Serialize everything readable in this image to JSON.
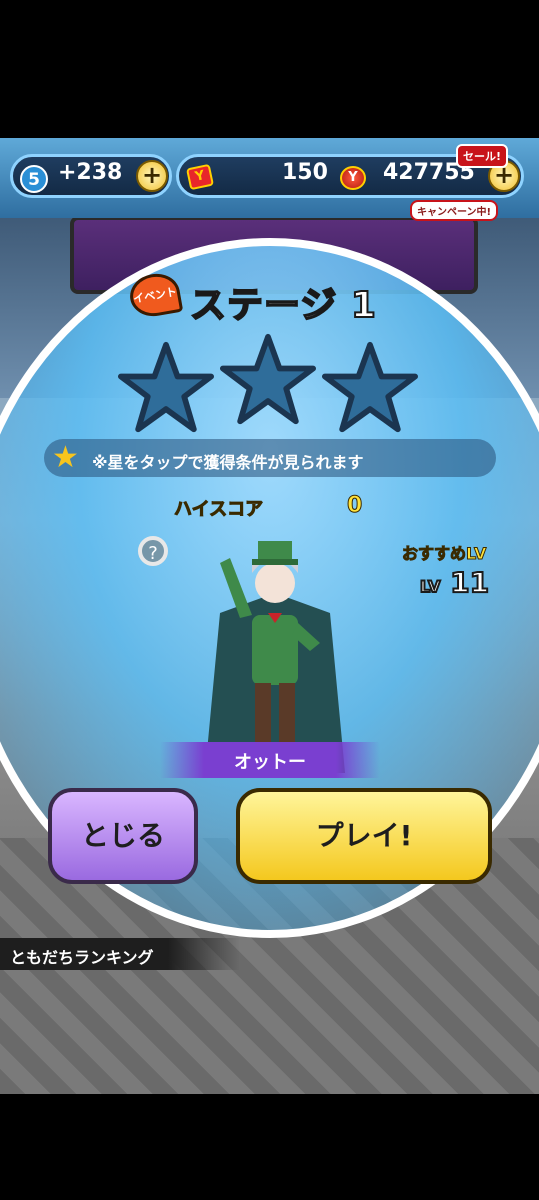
{
  "hud": {
    "stamina_level": "5",
    "stamina_bonus": "+238",
    "ticket_count": "150",
    "money_count": "427755",
    "sale_badge": "セール!",
    "campaign_badge": "キャンペーン中!",
    "plus_label": "+"
  },
  "stage": {
    "event_ribbon": "イベント",
    "title": "ステージ 1",
    "stars_earned": 0,
    "stars_total": 3,
    "hint_text": "※星をタップで獲得条件が見られます",
    "highscore_label": "ハイスコア",
    "highscore_value": "0",
    "recommended_label": "おすすめLV",
    "recommended_lv_prefix": "LV",
    "recommended_lv_value": "11"
  },
  "character": {
    "name": "オットー"
  },
  "buttons": {
    "close_label": "とじる",
    "play_label": "プレイ!"
  },
  "footer": {
    "friend_ranking": "ともだちランキング"
  },
  "colors": {
    "star_empty": "#2f6d9a",
    "accent_yellow": "#ffe23a",
    "close_button": "#b88df0",
    "play_button": "#f8d83a"
  }
}
